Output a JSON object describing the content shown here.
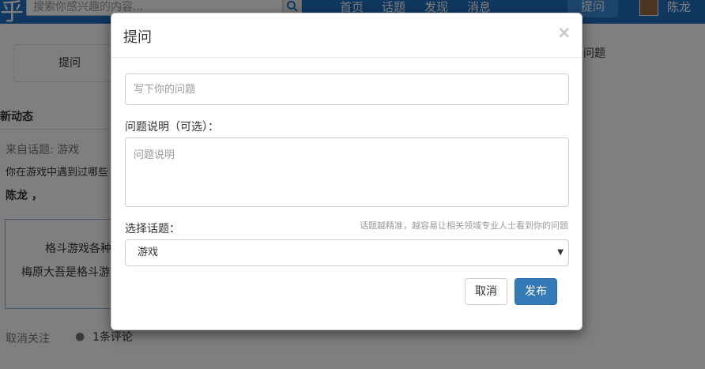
{
  "navbar": {
    "logo_char": "乎",
    "search_placeholder": "搜索你感兴趣的内容...",
    "nav_items": [
      "首页",
      "话题",
      "发现",
      "消息"
    ],
    "ask_button": "提问",
    "user_name": "陈龙",
    "colors": {
      "bar": "#1f6fbf",
      "ask": "#3a8ad8"
    }
  },
  "background": {
    "sidebar_ask": "提问",
    "section_title": "新动态",
    "from_topic": "来自话题: 游戏",
    "question_snippet": "你在游戏中遇到过哪些",
    "author": "陈龙 ，",
    "card_line1": "格斗游戏各种",
    "card_line2": "梅原大吾是格斗游",
    "unfollow": "取消关注",
    "comments": "1条评论",
    "right_snippet": "问题"
  },
  "modal": {
    "title": "提问",
    "close_glyph": "×",
    "question_placeholder": "写下你的问题",
    "description_label": "问题说明（可选）：",
    "description_placeholder": "问题说明",
    "topic_label": "选择话题：",
    "topic_hint": "话题越精准，越容易让相关领域专业人士看到你的问题",
    "topic_selected": "游戏",
    "cancel_label": "取消",
    "publish_label": "发布",
    "colors": {
      "primary": "#337ab7",
      "overlay": "rgba(0,0,0,0.5)"
    }
  }
}
